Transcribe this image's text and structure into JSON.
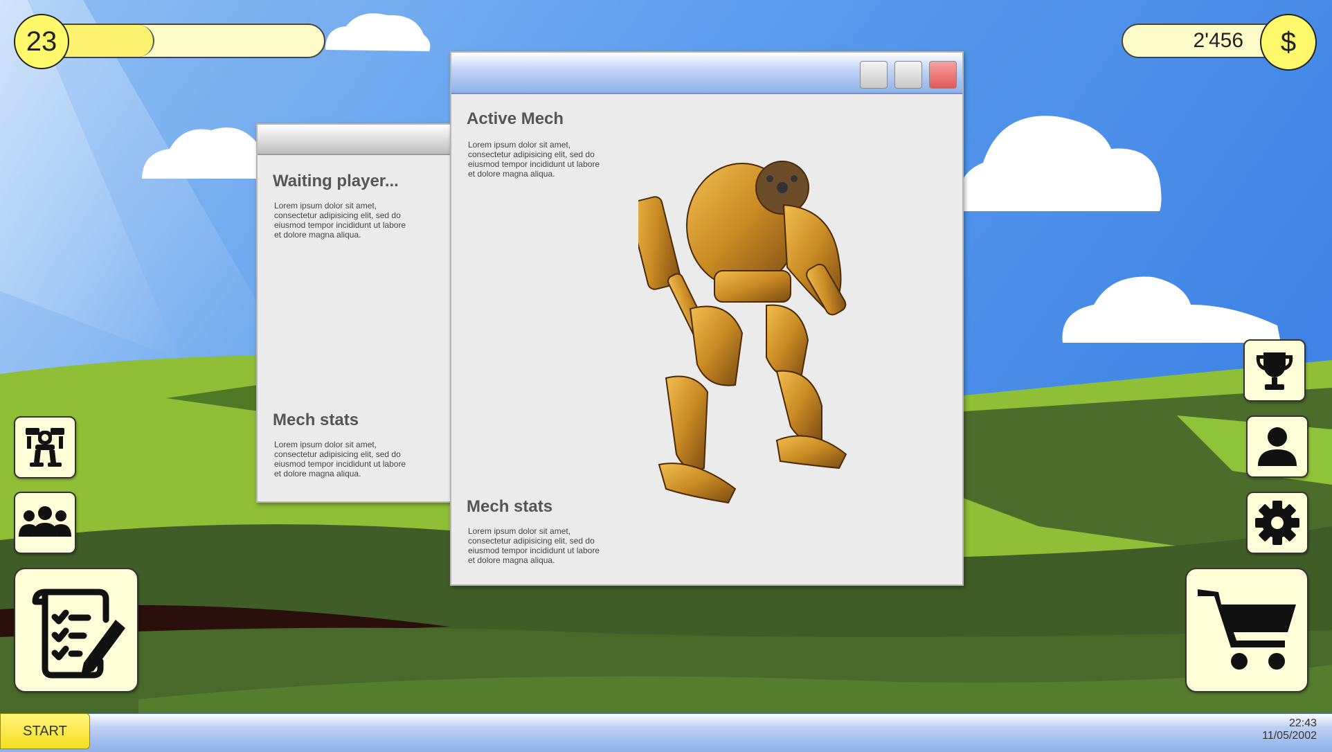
{
  "hud": {
    "level": "23",
    "xp_progress": 0.36,
    "money": "2'456",
    "currency_symbol": "$"
  },
  "windows": {
    "back": {
      "title": "Waiting player...",
      "text": "Lorem ipsum dolor sit amet, consectetur adipisicing elit, sed do eiusmod tempor incididunt ut labore et dolore magna aliqua.",
      "stats_title": "Mech stats",
      "stats_text": "Lorem ipsum dolor sit amet, consectetur adipisicing elit, sed do eiusmod tempor incididunt ut labore et dolore magna aliqua."
    },
    "front": {
      "title": "Active Mech",
      "text": "Lorem ipsum dolor sit amet, consectetur adipisicing elit, sed do eiusmod tempor incididunt ut labore et dolore magna aliqua.",
      "stats_title": "Mech stats",
      "stats_text": "Lorem ipsum dolor sit amet, consectetur adipisicing elit, sed do eiusmod tempor incididunt ut labore et dolore magna aliqua."
    }
  },
  "side_buttons": {
    "left": [
      "mech-icon",
      "group-icon",
      "checklist-edit-icon"
    ],
    "right": [
      "trophy-icon",
      "user-icon",
      "gear-icon",
      "cart-icon"
    ]
  },
  "taskbar": {
    "start_label": "START",
    "time": "22:43",
    "date": "11/05/2002"
  },
  "colors": {
    "sky": "#4f93ec",
    "hill_light": "#8ebf36",
    "hill_dark": "#3f5e27",
    "badge_yellow": "#fef86a",
    "close_red": "#f07070"
  }
}
